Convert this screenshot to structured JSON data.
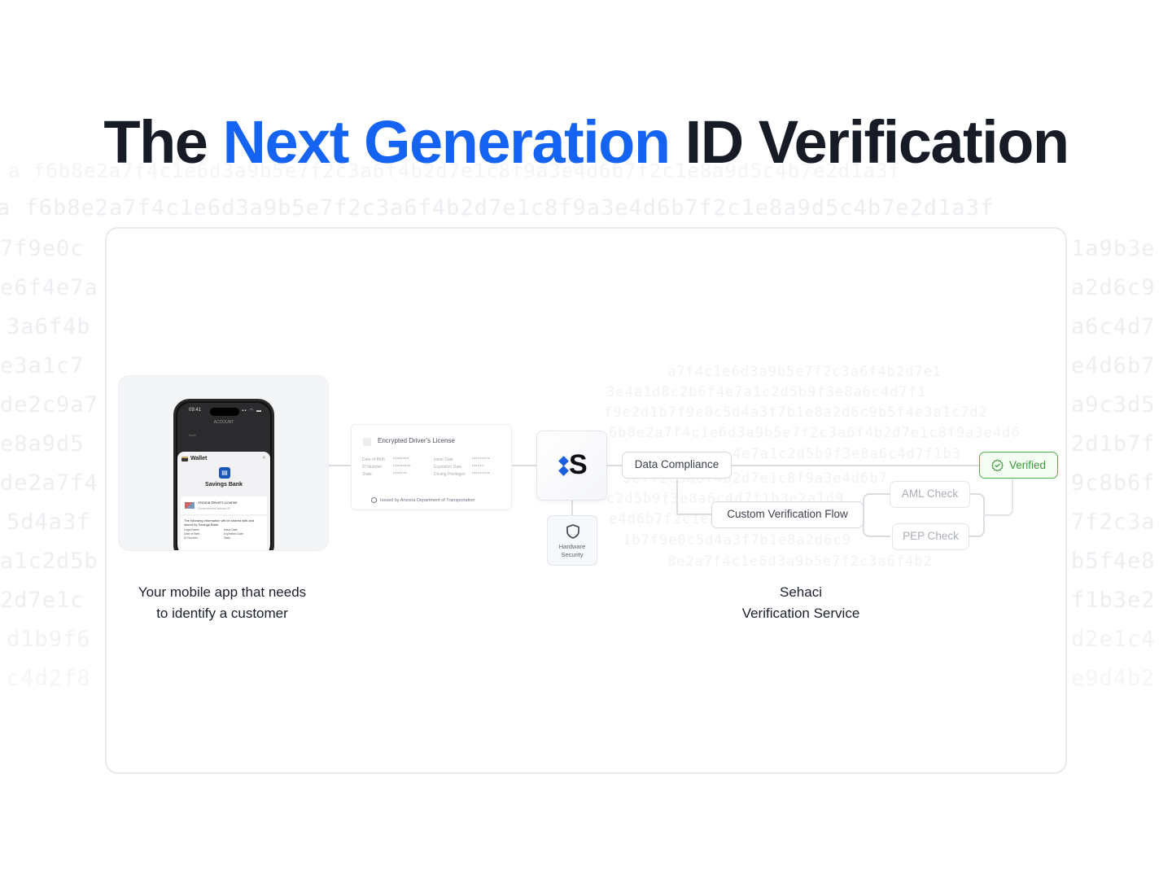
{
  "title": {
    "prefix": "The",
    "accent": "Next Generation",
    "suffix": "ID Verification",
    "accent_color": "#1463f3"
  },
  "background_hex": [
    "a f6b8e2a7f4c1e6d3a9b5e7f2c3a6f4b2d7e1c8f9a3e4d6b7f2c1e8a9d5c4b7e2d1a3f",
    "7f9e0c",
    "e6f4e7a",
    "3a6f4b",
    "e3a1c7",
    "de2c9a7",
    "e8a9d5",
    "de2a7f4",
    "5d4a3f",
    "a1c2d5b",
    "2d7e1c",
    "d1b9f6",
    "c4d2f8",
    "1a9b3e",
    "a2d6c9",
    "a6c4d7",
    "e4d6b7",
    "a9c3d5",
    "2d1b7f",
    "9c8b6f",
    "7f2c3a",
    "b5f4e8",
    "f1b3e2",
    "d2e1c4",
    "e9d4b2"
  ],
  "diagram_hex": [
    "a7f4c1e6d3a9b5e7f2c3a6f4b2d7e1",
    "3e4a1d8c2b6f4e7a1c2d5b9f3e8a6c4d7f1",
    "f9e2d1b7f9e0c5d4a3f7b1e8a2d6c9b5f4e3a1c7d2",
    "6b8e2a7f4c1e6d3a9b5e7f2c3a6f4b2d7e1c8f9a3e4d6",
    "4e7a1c2d5b9f3e8a6c4d7f1b3",
    "5e7f2c3a6f4b2d7e1c8f9a3e4d6b7",
    "c2d5b9f3e8a6c4d7f1b3e2a1d9",
    "e4d6b7f2c1e8a9d5c4b7",
    "1b7f9e0c5d4a3f7b1e8a2d6c9",
    "8e2a7f4c1e6d3a9b5e7f2c3a6f4b2"
  ],
  "mobile_app": {
    "phone": {
      "time": "09:41",
      "status_icons": "signal wifi battery",
      "screen_title": "ACCOUNT",
      "back_label": "Back",
      "wallet_label": "Wallet",
      "close_glyph": "✕",
      "bank_name": "Savings Bank",
      "license_title": "Arizona Driver's License",
      "license_subtitle": "Government Issued ID",
      "info_text": "The following information will be shared with and stored by Savings Bank:",
      "fields": [
        "Legal Name",
        "Issue Date",
        "Date of Birth",
        "Expiration Date",
        "ID Number",
        "State"
      ]
    },
    "caption_line1": "Your mobile app that needs",
    "caption_line2": "to identify a customer"
  },
  "license_card": {
    "title": "Encrypted Driver's License",
    "fields": [
      {
        "label": "Date of Birth",
        "value": "********"
      },
      {
        "label": "Issue Date",
        "value": "*********"
      },
      {
        "label": "ID Number",
        "value": "*********"
      },
      {
        "label": "Expiration Date",
        "value": "******"
      },
      {
        "label": "State",
        "value": "*******"
      },
      {
        "label": "Driving Privileges",
        "value": "*********"
      }
    ],
    "issued_by": "Issued by Arizona Department of Transportation"
  },
  "service": {
    "logo_letter": "S",
    "logo_color": "#1a5fe0",
    "hardware_label_line1": "Hardware",
    "hardware_label_line2": "Security",
    "nodes": {
      "data_compliance": "Data Compliance",
      "custom_flow": "Custom Verification Flow",
      "aml": "AML Check",
      "pep": "PEP Check",
      "verified": "Verified"
    },
    "verified_color": "#3a9a38",
    "caption_line1": "Sehaci",
    "caption_line2": "Verification Service"
  }
}
